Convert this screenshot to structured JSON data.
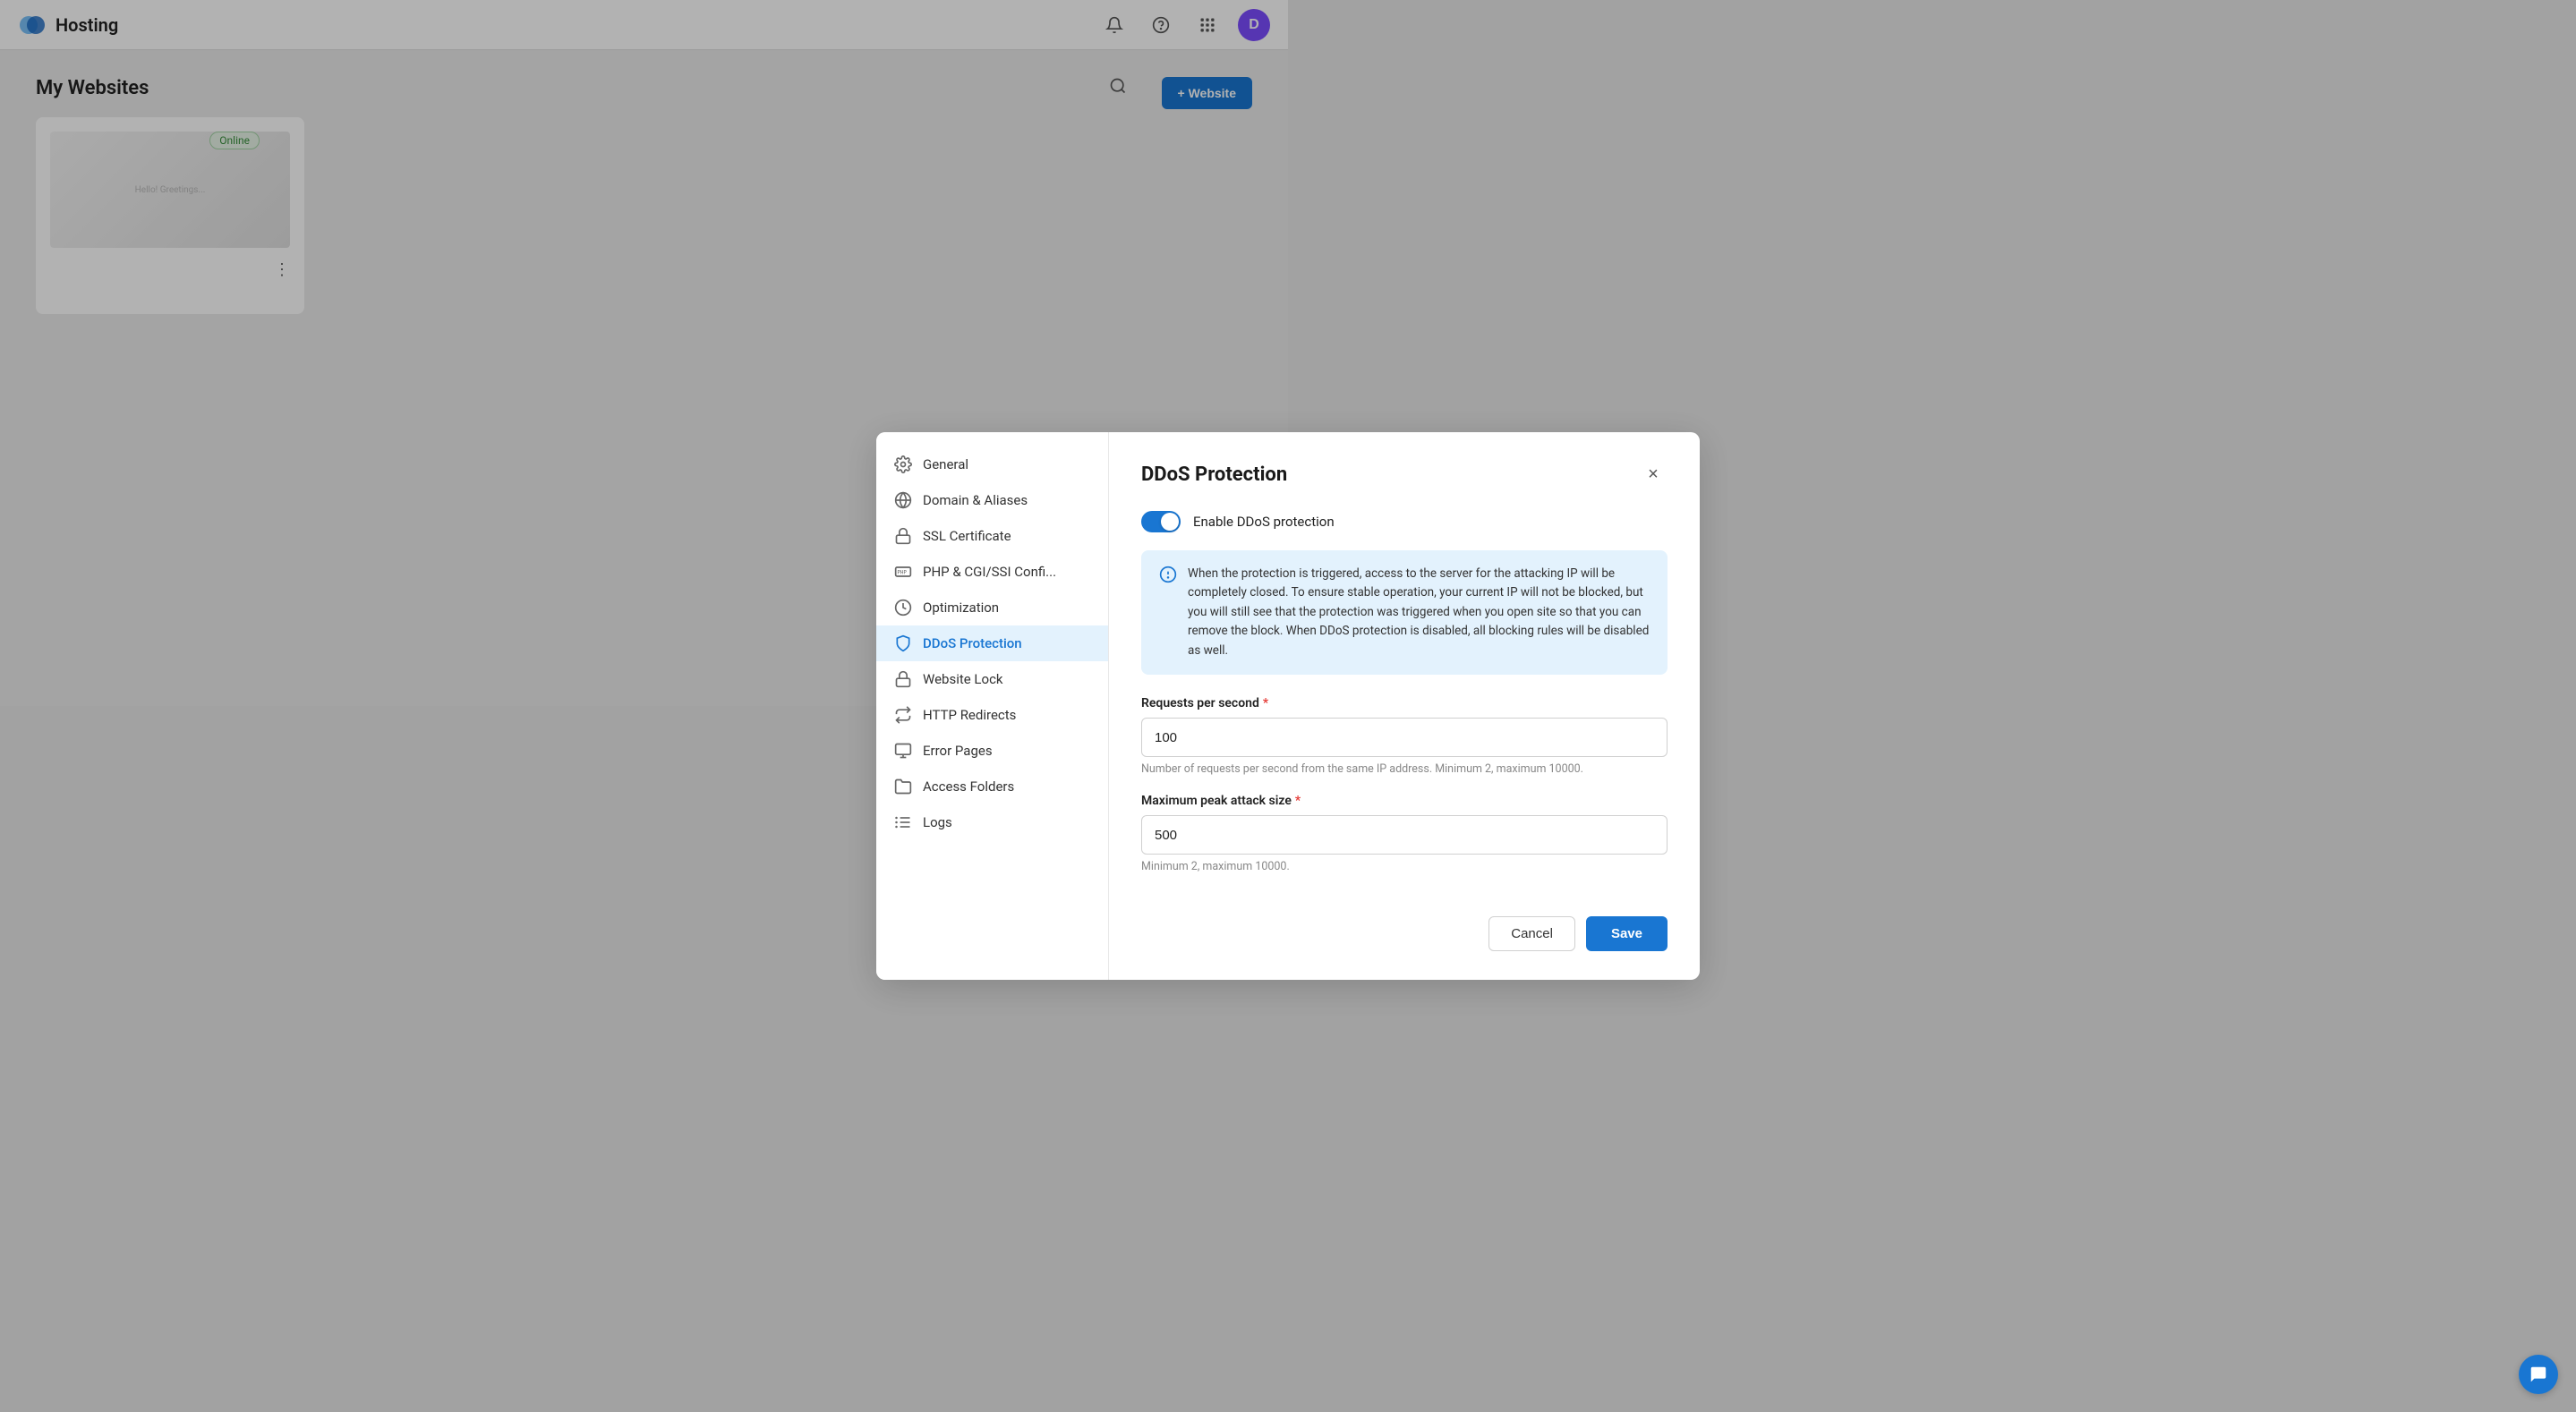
{
  "app": {
    "title": "Hosting",
    "avatar_label": "D"
  },
  "page": {
    "title": "My Websites",
    "add_website_label": "+ Website",
    "online_badge": "Online"
  },
  "modal": {
    "title": "DDoS Protection",
    "close_label": "×",
    "toggle_label": "Enable DDoS protection",
    "info_text": "When the protection is triggered, access to the server for the attacking IP will be completely closed. To ensure stable operation, your current IP will not be blocked, but you will still see that the protection was triggered when you open site so that you can remove the block. When DDoS protection is disabled, all blocking rules will be disabled as well.",
    "field1": {
      "label": "Requests per second",
      "value": "100",
      "hint": "Number of requests per second from the same IP address. Minimum 2, maximum 10000."
    },
    "field2": {
      "label": "Maximum peak attack size",
      "value": "500",
      "hint": "Minimum 2, maximum 10000."
    },
    "cancel_label": "Cancel",
    "save_label": "Save"
  },
  "sidebar": {
    "items": [
      {
        "id": "general",
        "label": "General",
        "icon": "gear"
      },
      {
        "id": "domain-aliases",
        "label": "Domain & Aliases",
        "icon": "www"
      },
      {
        "id": "ssl-certificate",
        "label": "SSL Certificate",
        "icon": "ssl"
      },
      {
        "id": "php-cgi",
        "label": "PHP & CGI/SSI Confi...",
        "icon": "php"
      },
      {
        "id": "optimization",
        "label": "Optimization",
        "icon": "optimization"
      },
      {
        "id": "ddos-protection",
        "label": "DDoS Protection",
        "icon": "shield",
        "active": true
      },
      {
        "id": "website-lock",
        "label": "Website Lock",
        "icon": "lock"
      },
      {
        "id": "http-redirects",
        "label": "HTTP Redirects",
        "icon": "redirect"
      },
      {
        "id": "error-pages",
        "label": "Error Pages",
        "icon": "error"
      },
      {
        "id": "access-folders",
        "label": "Access Folders",
        "icon": "folder"
      },
      {
        "id": "logs",
        "label": "Logs",
        "icon": "logs"
      }
    ]
  }
}
